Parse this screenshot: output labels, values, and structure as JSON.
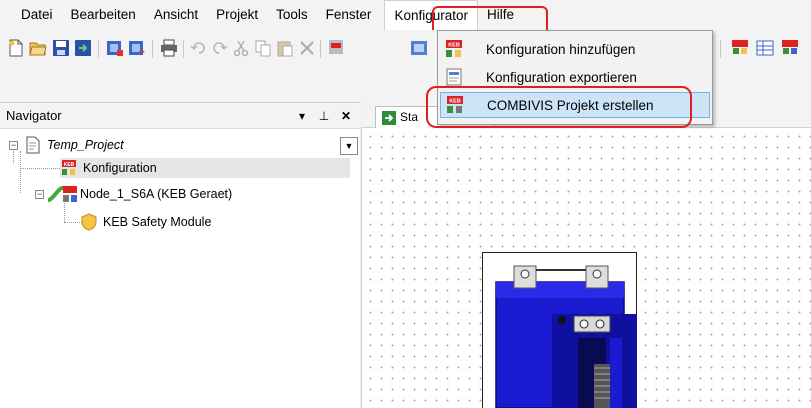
{
  "menubar": {
    "items": [
      "Datei",
      "Bearbeiten",
      "Ansicht",
      "Projekt",
      "Tools",
      "Fenster",
      "Konfigurator",
      "Hilfe"
    ],
    "active": "Konfigurator"
  },
  "dropdown": {
    "items": [
      {
        "label": "Konfiguration hinzufügen",
        "icon": "keb-config-add-icon"
      },
      {
        "label": "Konfiguration exportieren",
        "icon": "export-icon"
      },
      {
        "label": "COMBIVIS Projekt erstellen",
        "icon": "combivis-project-icon",
        "highlighted": true
      }
    ]
  },
  "navigator": {
    "title": "Navigator",
    "pin_glyph": "⊥",
    "close_glyph": "✕",
    "menu_glyph": "▾",
    "tree": {
      "root": "Temp_Project",
      "configuration": "Konfiguration",
      "node": "Node_1_S6A (KEB Geraet)",
      "module": "KEB Safety Module"
    }
  },
  "editor": {
    "tab_label": "Sta"
  },
  "colors": {
    "highlight_red": "#e02020",
    "hover_blue": "#cce4f7",
    "device_blue": "#1a1ad0"
  }
}
